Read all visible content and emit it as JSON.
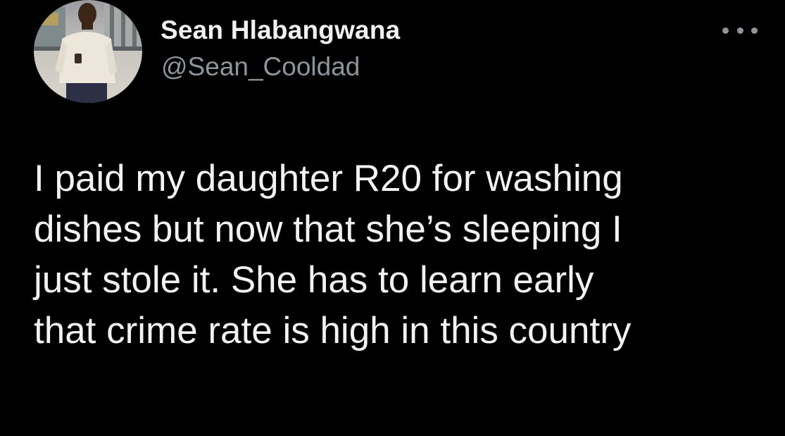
{
  "tweet": {
    "author": {
      "display_name": "Sean Hlabangwana",
      "handle": "@Sean_Cooldad",
      "avatar_icon": "profile-photo"
    },
    "more_icon": "ellipsis-icon",
    "text_lines": [
      "I paid my daughter R20 for washing",
      "dishes but now that she’s sleeping I",
      "just stole it. She has to learn early",
      "that crime rate is high in this country"
    ]
  },
  "colors": {
    "background": "#000000",
    "primary_text": "#f2f2f2",
    "secondary_text": "#8d959c"
  }
}
